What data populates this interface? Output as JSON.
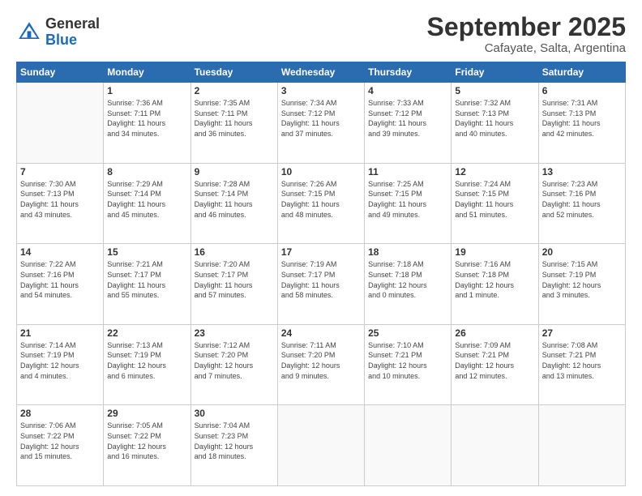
{
  "logo": {
    "general": "General",
    "blue": "Blue"
  },
  "title": "September 2025",
  "subtitle": "Cafayate, Salta, Argentina",
  "days_header": [
    "Sunday",
    "Monday",
    "Tuesday",
    "Wednesday",
    "Thursday",
    "Friday",
    "Saturday"
  ],
  "weeks": [
    [
      {
        "day": "",
        "info": ""
      },
      {
        "day": "1",
        "info": "Sunrise: 7:36 AM\nSunset: 7:11 PM\nDaylight: 11 hours\nand 34 minutes."
      },
      {
        "day": "2",
        "info": "Sunrise: 7:35 AM\nSunset: 7:11 PM\nDaylight: 11 hours\nand 36 minutes."
      },
      {
        "day": "3",
        "info": "Sunrise: 7:34 AM\nSunset: 7:12 PM\nDaylight: 11 hours\nand 37 minutes."
      },
      {
        "day": "4",
        "info": "Sunrise: 7:33 AM\nSunset: 7:12 PM\nDaylight: 11 hours\nand 39 minutes."
      },
      {
        "day": "5",
        "info": "Sunrise: 7:32 AM\nSunset: 7:13 PM\nDaylight: 11 hours\nand 40 minutes."
      },
      {
        "day": "6",
        "info": "Sunrise: 7:31 AM\nSunset: 7:13 PM\nDaylight: 11 hours\nand 42 minutes."
      }
    ],
    [
      {
        "day": "7",
        "info": "Sunrise: 7:30 AM\nSunset: 7:13 PM\nDaylight: 11 hours\nand 43 minutes."
      },
      {
        "day": "8",
        "info": "Sunrise: 7:29 AM\nSunset: 7:14 PM\nDaylight: 11 hours\nand 45 minutes."
      },
      {
        "day": "9",
        "info": "Sunrise: 7:28 AM\nSunset: 7:14 PM\nDaylight: 11 hours\nand 46 minutes."
      },
      {
        "day": "10",
        "info": "Sunrise: 7:26 AM\nSunset: 7:15 PM\nDaylight: 11 hours\nand 48 minutes."
      },
      {
        "day": "11",
        "info": "Sunrise: 7:25 AM\nSunset: 7:15 PM\nDaylight: 11 hours\nand 49 minutes."
      },
      {
        "day": "12",
        "info": "Sunrise: 7:24 AM\nSunset: 7:15 PM\nDaylight: 11 hours\nand 51 minutes."
      },
      {
        "day": "13",
        "info": "Sunrise: 7:23 AM\nSunset: 7:16 PM\nDaylight: 11 hours\nand 52 minutes."
      }
    ],
    [
      {
        "day": "14",
        "info": "Sunrise: 7:22 AM\nSunset: 7:16 PM\nDaylight: 11 hours\nand 54 minutes."
      },
      {
        "day": "15",
        "info": "Sunrise: 7:21 AM\nSunset: 7:17 PM\nDaylight: 11 hours\nand 55 minutes."
      },
      {
        "day": "16",
        "info": "Sunrise: 7:20 AM\nSunset: 7:17 PM\nDaylight: 11 hours\nand 57 minutes."
      },
      {
        "day": "17",
        "info": "Sunrise: 7:19 AM\nSunset: 7:17 PM\nDaylight: 11 hours\nand 58 minutes."
      },
      {
        "day": "18",
        "info": "Sunrise: 7:18 AM\nSunset: 7:18 PM\nDaylight: 12 hours\nand 0 minutes."
      },
      {
        "day": "19",
        "info": "Sunrise: 7:16 AM\nSunset: 7:18 PM\nDaylight: 12 hours\nand 1 minute."
      },
      {
        "day": "20",
        "info": "Sunrise: 7:15 AM\nSunset: 7:19 PM\nDaylight: 12 hours\nand 3 minutes."
      }
    ],
    [
      {
        "day": "21",
        "info": "Sunrise: 7:14 AM\nSunset: 7:19 PM\nDaylight: 12 hours\nand 4 minutes."
      },
      {
        "day": "22",
        "info": "Sunrise: 7:13 AM\nSunset: 7:19 PM\nDaylight: 12 hours\nand 6 minutes."
      },
      {
        "day": "23",
        "info": "Sunrise: 7:12 AM\nSunset: 7:20 PM\nDaylight: 12 hours\nand 7 minutes."
      },
      {
        "day": "24",
        "info": "Sunrise: 7:11 AM\nSunset: 7:20 PM\nDaylight: 12 hours\nand 9 minutes."
      },
      {
        "day": "25",
        "info": "Sunrise: 7:10 AM\nSunset: 7:21 PM\nDaylight: 12 hours\nand 10 minutes."
      },
      {
        "day": "26",
        "info": "Sunrise: 7:09 AM\nSunset: 7:21 PM\nDaylight: 12 hours\nand 12 minutes."
      },
      {
        "day": "27",
        "info": "Sunrise: 7:08 AM\nSunset: 7:21 PM\nDaylight: 12 hours\nand 13 minutes."
      }
    ],
    [
      {
        "day": "28",
        "info": "Sunrise: 7:06 AM\nSunset: 7:22 PM\nDaylight: 12 hours\nand 15 minutes."
      },
      {
        "day": "29",
        "info": "Sunrise: 7:05 AM\nSunset: 7:22 PM\nDaylight: 12 hours\nand 16 minutes."
      },
      {
        "day": "30",
        "info": "Sunrise: 7:04 AM\nSunset: 7:23 PM\nDaylight: 12 hours\nand 18 minutes."
      },
      {
        "day": "",
        "info": ""
      },
      {
        "day": "",
        "info": ""
      },
      {
        "day": "",
        "info": ""
      },
      {
        "day": "",
        "info": ""
      }
    ]
  ]
}
